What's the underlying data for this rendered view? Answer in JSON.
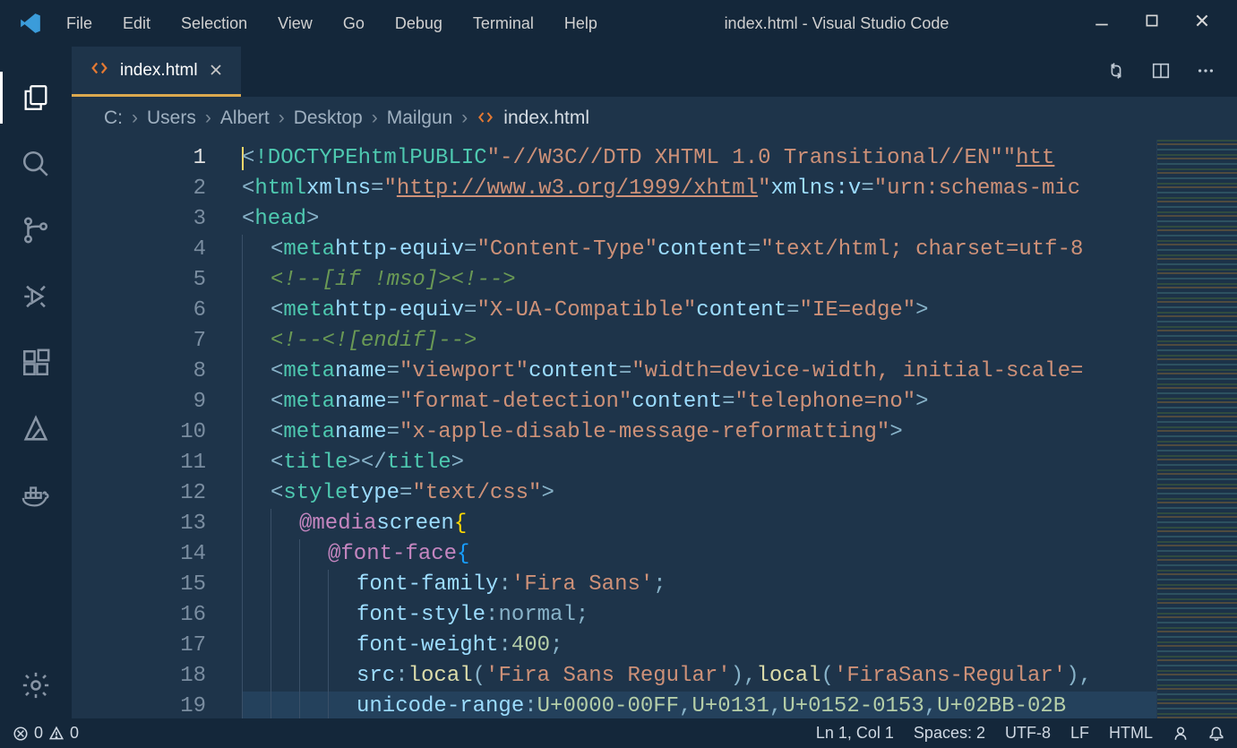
{
  "window": {
    "title": "index.html - Visual Studio Code"
  },
  "menu": [
    "File",
    "Edit",
    "Selection",
    "View",
    "Go",
    "Debug",
    "Terminal",
    "Help"
  ],
  "tab": {
    "label": "index.html"
  },
  "breadcrumbs": {
    "segments": [
      "C:",
      "Users",
      "Albert",
      "Desktop",
      "Mailgun"
    ],
    "file": "index.html"
  },
  "editor": {
    "lines": [
      {
        "n": 1,
        "html": "<span class='cursor'></span><span class='p'>&lt;</span><span class='t'>!DOCTYPE</span> <span class='t'>html</span> <span class='t'>PUBLIC</span> <span class='s'>\"-//W3C//DTD XHTML 1.0 Transitional//EN\"</span> <span class='s'>\"</span><span class='lnk'>htt</span>"
      },
      {
        "n": 2,
        "html": "<span class='p'>&lt;</span><span class='t'>html</span> <span class='a'>xmlns</span><span class='p'>=</span><span class='s'>\"</span><span class='lnk'>http://www.w3.org/1999/xhtml</span><span class='s'>\"</span> <span class='a'>xmlns:v</span><span class='p'>=</span><span class='s'>\"urn:schemas-mic</span>"
      },
      {
        "n": 3,
        "html": "<span class='p'>&lt;</span><span class='t'>head</span><span class='p'>&gt;</span>"
      },
      {
        "n": 4,
        "indent": 1,
        "html": "<span class='p'>&lt;</span><span class='t'>meta</span> <span class='a'>http-equiv</span><span class='p'>=</span><span class='s'>\"Content-Type\"</span> <span class='a'>content</span><span class='p'>=</span><span class='s'>\"text/html; charset=utf-8</span>"
      },
      {
        "n": 5,
        "indent": 1,
        "html": "<span class='c'>&lt;!--[if !mso]&gt;&lt;!--&gt;</span>"
      },
      {
        "n": 6,
        "indent": 1,
        "html": "<span class='p'>&lt;</span><span class='t'>meta</span> <span class='a'>http-equiv</span><span class='p'>=</span><span class='s'>\"X-UA-Compatible\"</span> <span class='a'>content</span><span class='p'>=</span><span class='s'>\"IE=edge\"</span><span class='p'>&gt;</span>"
      },
      {
        "n": 7,
        "indent": 1,
        "html": "<span class='c'>&lt;!--&lt;![endif]--&gt;</span>"
      },
      {
        "n": 8,
        "indent": 1,
        "html": "<span class='p'>&lt;</span><span class='t'>meta</span> <span class='a'>name</span><span class='p'>=</span><span class='s'>\"viewport\"</span> <span class='a'>content</span><span class='p'>=</span><span class='s'>\"width=device-width, initial-scale=</span>"
      },
      {
        "n": 9,
        "indent": 1,
        "html": "<span class='p'>&lt;</span><span class='t'>meta</span> <span class='a'>name</span><span class='p'>=</span><span class='s'>\"format-detection\"</span> <span class='a'>content</span><span class='p'>=</span><span class='s'>\"telephone=no\"</span><span class='p'>&gt;</span>"
      },
      {
        "n": 10,
        "indent": 1,
        "html": "<span class='p'>&lt;</span><span class='t'>meta</span> <span class='a'>name</span><span class='p'>=</span><span class='s'>\"x-apple-disable-message-reformatting\"</span><span class='p'>&gt;</span>"
      },
      {
        "n": 11,
        "indent": 1,
        "html": "<span class='p'>&lt;</span><span class='t'>title</span><span class='p'>&gt;&lt;/</span><span class='t'>title</span><span class='p'>&gt;</span>"
      },
      {
        "n": 12,
        "indent": 1,
        "html": "<span class='p'>&lt;</span><span class='t'>style</span> <span class='a'>type</span><span class='p'>=</span><span class='s'>\"text/css\"</span><span class='p'>&gt;</span>"
      },
      {
        "n": 13,
        "indent": 2,
        "html": "<span class='k'>@media</span> <span class='pr'>screen</span> <span class='bry'>{</span>"
      },
      {
        "n": 14,
        "indent": 3,
        "html": "<span class='k'>@font-face</span> <span class='br'>{</span>"
      },
      {
        "n": 15,
        "indent": 4,
        "html": "<span class='pr'>font-family</span><span class='p'>:</span> <span class='s'>'Fira Sans'</span><span class='p'>;</span>"
      },
      {
        "n": 16,
        "indent": 4,
        "html": "<span class='pr'>font-style</span><span class='p'>:</span> <span class='p'>normal;</span>"
      },
      {
        "n": 17,
        "indent": 4,
        "html": "<span class='pr'>font-weight</span><span class='p'>:</span> <span class='n'>400</span><span class='p'>;</span>"
      },
      {
        "n": 18,
        "indent": 4,
        "html": "<span class='pr'>src</span><span class='p'>:</span> <span class='fn'>local</span><span class='p'>(</span><span class='s'>'Fira Sans Regular'</span><span class='p'>),</span> <span class='fn'>local</span><span class='p'>(</span><span class='s'>'FiraSans-Regular'</span><span class='p'>),</span>"
      },
      {
        "n": 19,
        "indent": 4,
        "hl": true,
        "html": "<span class='pr'>unicode-range</span><span class='p'>:</span> <span class='n'>U+0000-00FF</span><span class='p'>,</span> <span class='n'>U+0131</span><span class='p'>,</span> <span class='n'>U+0152-0153</span><span class='p'>,</span> <span class='n'>U+02BB-02B</span>"
      }
    ]
  },
  "status": {
    "errors": "0",
    "warnings": "0",
    "position": "Ln 1, Col 1",
    "spaces": "Spaces: 2",
    "encoding": "UTF-8",
    "eol": "LF",
    "language": "HTML"
  }
}
